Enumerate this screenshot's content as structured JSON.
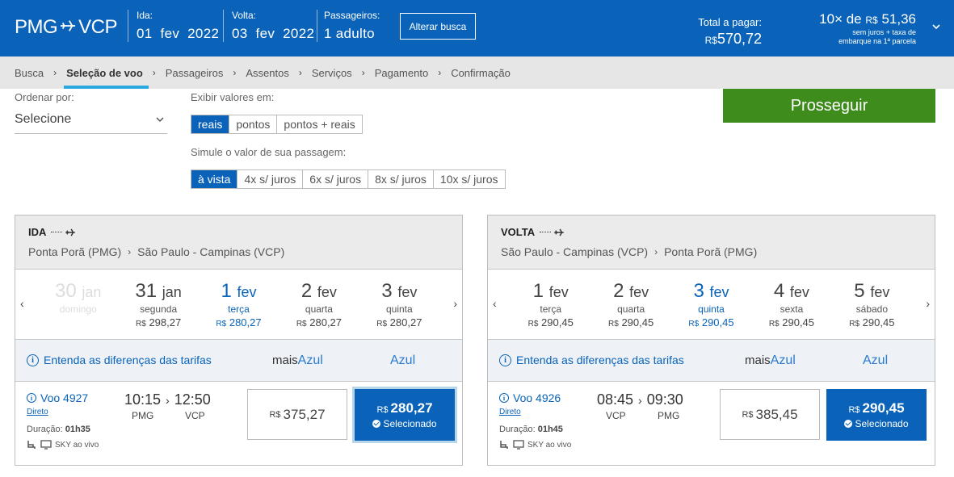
{
  "header": {
    "from": "PMG",
    "to": "VCP",
    "ida_label": "Ida:",
    "ida_value": "01  fev  2022",
    "volta_label": "Volta:",
    "volta_value": "03  fev  2022",
    "pax_label": "Passageiros:",
    "pax_value": "1 adulto",
    "alter_button": "Alterar busca",
    "total_label": "Total a pagar:",
    "total_currency": "R$",
    "total_value": "570,72",
    "inst_prefix": "10× de",
    "inst_currency": "R$",
    "inst_value": "51,36",
    "inst_note1": "sem juros + taxa de",
    "inst_note2": "embarque na 1ª parcela"
  },
  "breadcrumb": [
    "Busca",
    "Seleção de voo",
    "Passageiros",
    "Assentos",
    "Serviços",
    "Pagamento",
    "Confirmação"
  ],
  "filters": {
    "sort_label": "Ordenar por:",
    "sort_value": "Selecione",
    "display_label": "Exibir valores em:",
    "display_options": [
      "reais",
      "pontos",
      "pontos + reais"
    ],
    "simulate_label": "Simule o valor de sua passagem:",
    "simulate_options": [
      "à vista",
      "4x s/ juros",
      "6x s/ juros",
      "8x s/ juros",
      "10x s/ juros"
    ],
    "proceed_button": "Prosseguir"
  },
  "ida": {
    "direction": "IDA",
    "origin": "Ponta Porã (PMG)",
    "destination": "São Paulo - Campinas (VCP)",
    "days": [
      {
        "num": "30",
        "mon": "jan",
        "wk": "domingo",
        "cur": "",
        "price": ""
      },
      {
        "num": "31",
        "mon": "jan",
        "wk": "segunda",
        "cur": "R$",
        "price": "298,27"
      },
      {
        "num": "1",
        "mon": "fev",
        "wk": "terça",
        "cur": "R$",
        "price": "280,27"
      },
      {
        "num": "2",
        "mon": "fev",
        "wk": "quarta",
        "cur": "R$",
        "price": "280,27"
      },
      {
        "num": "3",
        "mon": "fev",
        "wk": "quinta",
        "cur": "R$",
        "price": "280,27"
      }
    ],
    "info_link": "Entenda as diferenças das tarifas",
    "fare1_mais": "mais",
    "fare1_azul": "Azul",
    "fare2": "Azul",
    "flight_no": "Voo 4927",
    "direct": "Direto",
    "duration_label": "Duração:",
    "duration": "01h35",
    "amenity": "SKY ao vivo",
    "dep_time": "10:15",
    "arr_time": "12:50",
    "dep_airport": "PMG",
    "arr_airport": "VCP",
    "price1_cur": "R$",
    "price1": "375,27",
    "price2_cur": "R$",
    "price2": "280,27",
    "selected": "Selecionado"
  },
  "volta": {
    "direction": "VOLTA",
    "origin": "São Paulo - Campinas (VCP)",
    "destination": "Ponta Porã (PMG)",
    "days": [
      {
        "num": "1",
        "mon": "fev",
        "wk": "terça",
        "cur": "R$",
        "price": "290,45"
      },
      {
        "num": "2",
        "mon": "fev",
        "wk": "quarta",
        "cur": "R$",
        "price": "290,45"
      },
      {
        "num": "3",
        "mon": "fev",
        "wk": "quinta",
        "cur": "R$",
        "price": "290,45"
      },
      {
        "num": "4",
        "mon": "fev",
        "wk": "sexta",
        "cur": "R$",
        "price": "290,45"
      },
      {
        "num": "5",
        "mon": "fev",
        "wk": "sábado",
        "cur": "R$",
        "price": "290,45"
      }
    ],
    "info_link": "Entenda as diferenças das tarifas",
    "fare1_mais": "mais",
    "fare1_azul": "Azul",
    "fare2": "Azul",
    "flight_no": "Voo 4926",
    "direct": "Direto",
    "duration_label": "Duração:",
    "duration": "01h45",
    "amenity": "SKY ao vivo",
    "dep_time": "08:45",
    "arr_time": "09:30",
    "dep_airport": "VCP",
    "arr_airport": "PMG",
    "price1_cur": "R$",
    "price1": "385,45",
    "price2_cur": "R$",
    "price2": "290,45",
    "selected": "Selecionado"
  }
}
